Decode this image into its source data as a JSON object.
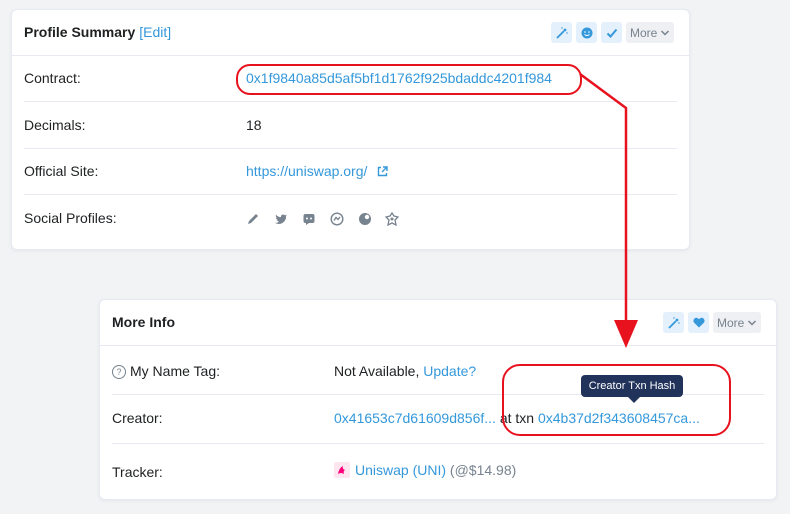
{
  "profile_summary": {
    "title": "Profile Summary",
    "edit_label": "[Edit]",
    "more_label": "More",
    "rows": {
      "contract": {
        "label": "Contract:",
        "value": "0x1f9840a85d5af5bf1d1762f925bdaddc4201f984"
      },
      "decimals": {
        "label": "Decimals:",
        "value": "18"
      },
      "site": {
        "label": "Official Site:",
        "value": "https://uniswap.org/"
      },
      "social": {
        "label": "Social Profiles:",
        "icons": [
          "pencil-icon",
          "twitter-icon",
          "discord-icon",
          "chat-icon",
          "medium-icon",
          "github-icon"
        ]
      }
    }
  },
  "more_info": {
    "title": "More Info",
    "more_label": "More",
    "rows": {
      "name_tag": {
        "label": "My Name Tag:",
        "value": "Not Available,",
        "update_link": "Update?"
      },
      "creator": {
        "label": "Creator:",
        "address": "0x41653c7d61609d856f...",
        "at_txn": "at txn",
        "txn": "0x4b37d2f343608457ca..."
      },
      "tracker": {
        "label": "Tracker:",
        "token": "Uniswap (UNI)",
        "price": "(@$14.98)"
      }
    }
  },
  "tooltip": {
    "text": "Creator Txn Hash"
  },
  "colors": {
    "link": "#3498db",
    "annotation": "#e8121e",
    "tooltip_bg": "#21325b"
  }
}
